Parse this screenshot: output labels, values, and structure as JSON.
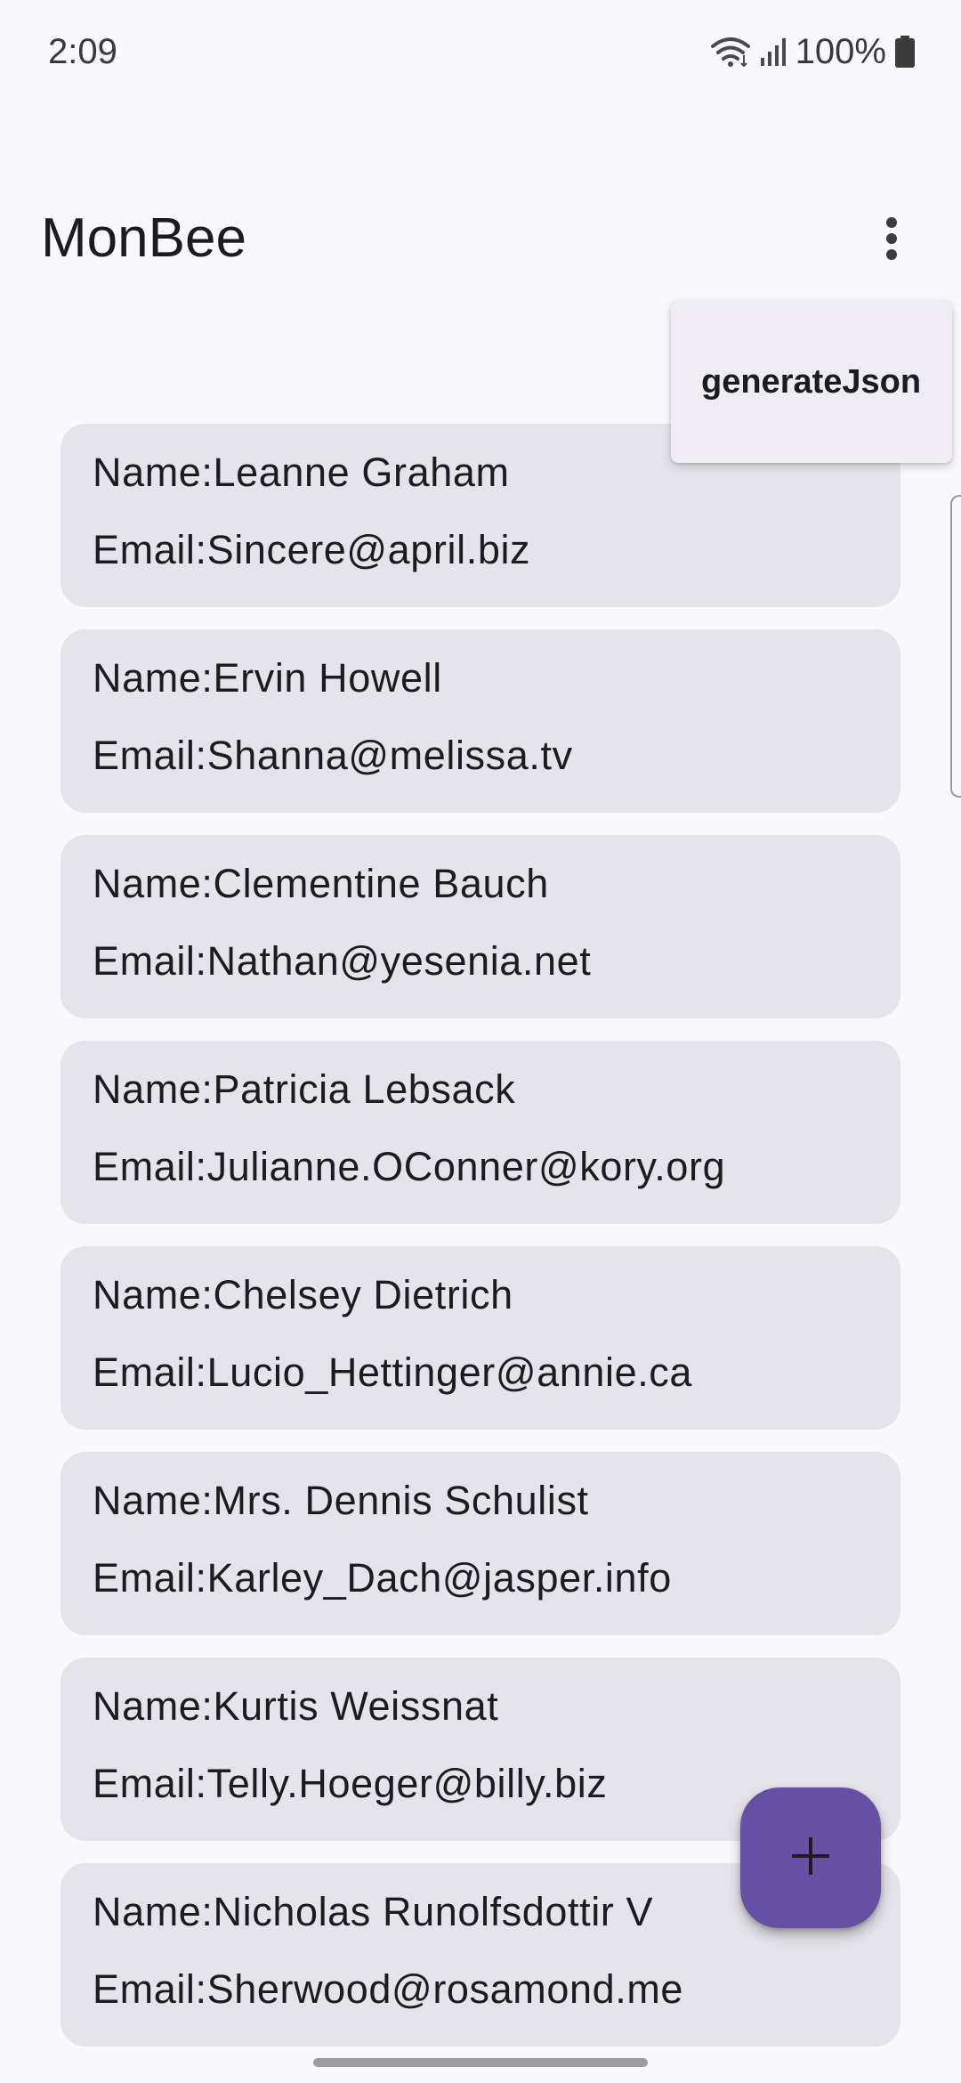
{
  "status_bar": {
    "time": "2:09",
    "battery": "100%"
  },
  "app_bar": {
    "title": "MonBee",
    "overflow_icon": "more-vert-icon"
  },
  "menu": {
    "items": [
      {
        "label": "generateJson"
      }
    ]
  },
  "users": [
    {
      "name": "Name:Leanne Graham",
      "email": "Email:Sincere@april.biz"
    },
    {
      "name": "Name:Ervin Howell",
      "email": "Email:Shanna@melissa.tv"
    },
    {
      "name": "Name:Clementine Bauch",
      "email": "Email:Nathan@yesenia.net"
    },
    {
      "name": "Name:Patricia Lebsack",
      "email": "Email:Julianne.OConner@kory.org"
    },
    {
      "name": "Name:Chelsey Dietrich",
      "email": "Email:Lucio_Hettinger@annie.ca"
    },
    {
      "name": "Name:Mrs. Dennis Schulist",
      "email": "Email:Karley_Dach@jasper.info"
    },
    {
      "name": "Name:Kurtis Weissnat",
      "email": "Email:Telly.Hoeger@billy.biz"
    },
    {
      "name": "Name:Nicholas Runolfsdottir V",
      "email": "Email:Sherwood@rosamond.me"
    }
  ],
  "fab": {
    "icon": "add-icon"
  },
  "colors": {
    "background": "#f8f8fd",
    "card": "#e5e4ea",
    "accent": "#6750a4",
    "menu": "#efedf3"
  }
}
